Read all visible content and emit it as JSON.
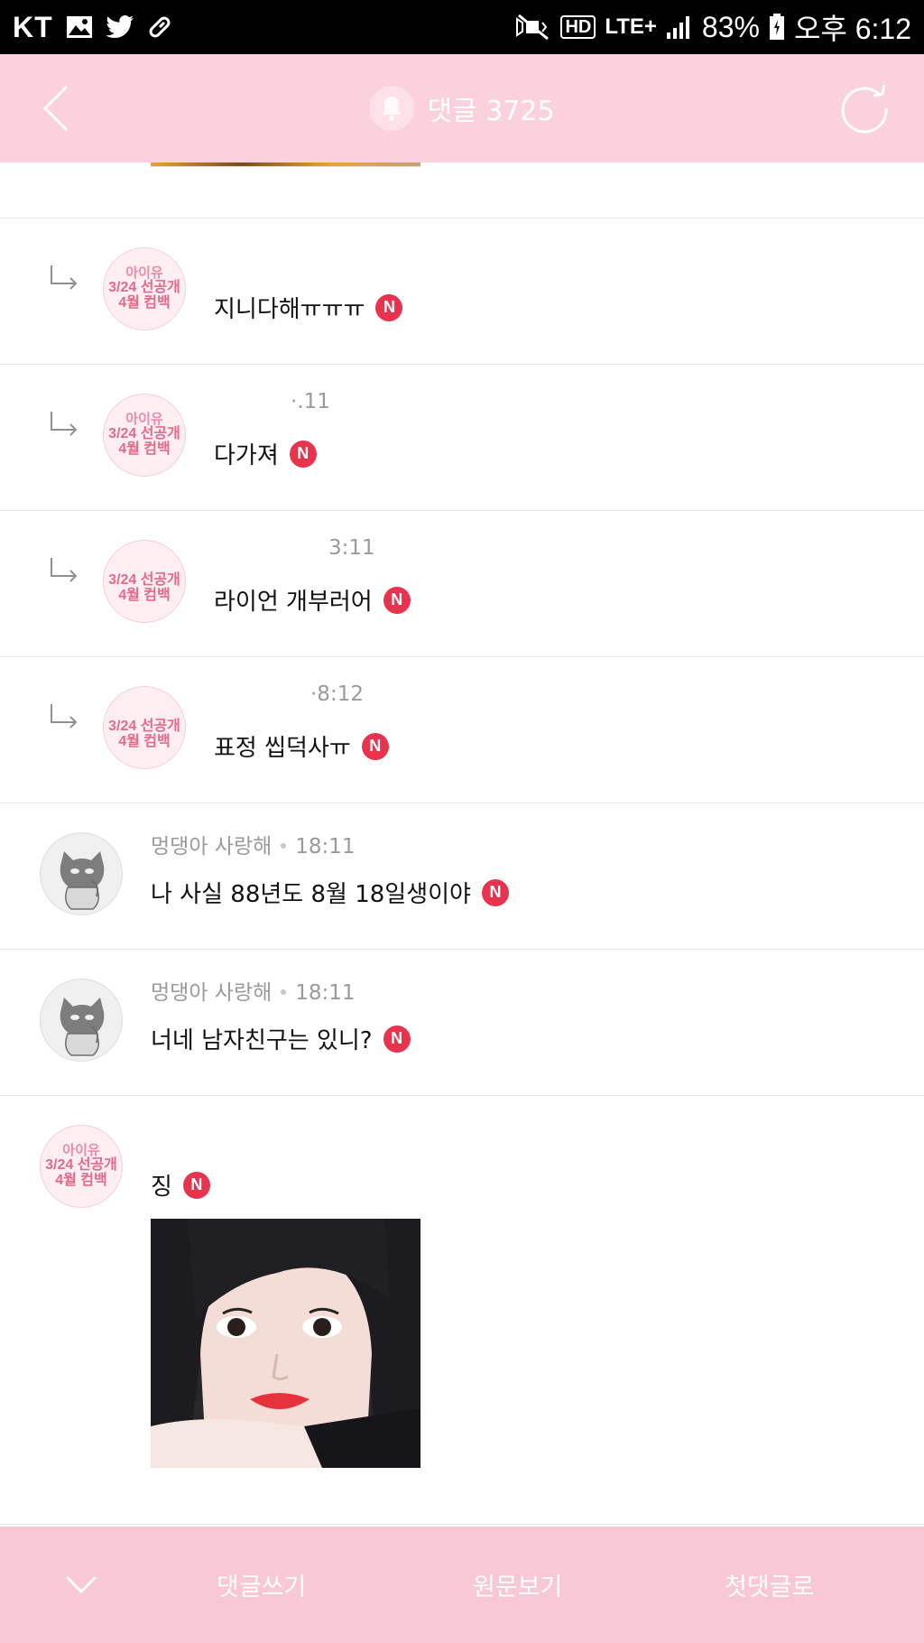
{
  "status_bar": {
    "carrier": "KT",
    "network": "LTE+",
    "hd": "HD",
    "battery": "83%",
    "time": "오후 6:12"
  },
  "header": {
    "title": "댓글 3725"
  },
  "comments": [
    {
      "meta": "",
      "text": "지니다해ㅠㅠㅠ"
    },
    {
      "meta": "·.11",
      "text": "다가져"
    },
    {
      "meta": "3:11",
      "text": "라이언 개부러어"
    },
    {
      "meta": "·8:12",
      "text": "표정 씹덕사ㅠ"
    },
    {
      "author": "멍댕아 사랑해",
      "time": "18:11",
      "text": "나 사실 88년도 8월 18일생이야"
    },
    {
      "author": "멍댕아 사랑해",
      "time": "18:11",
      "text": "너네 남자친구는 있니?"
    },
    {
      "meta": "",
      "text": "징"
    }
  ],
  "avatar_iu": {
    "line1": "아이유",
    "line2": "3/24 선공개",
    "line3": "4월 컴백"
  },
  "badge": "N",
  "bottom_bar": {
    "write": "댓글쓰기",
    "original": "원문보기",
    "first": "첫댓글로"
  },
  "colors": {
    "header_pink": "#fad1dc",
    "bottom_pink": "#f8c8d4",
    "badge_red": "#e8334f"
  }
}
